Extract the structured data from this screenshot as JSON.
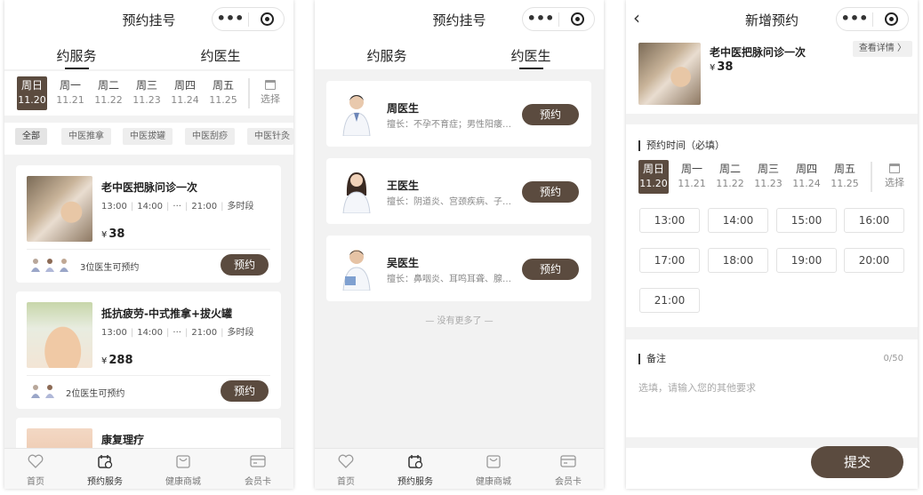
{
  "colors": {
    "accent": "#5b4b3f",
    "page_bg": "#f2f2f2"
  },
  "screen1": {
    "title": "预约挂号",
    "tabs": [
      "约服务",
      "约医生"
    ],
    "active_tab": 0,
    "dates": [
      {
        "weekday": "周日",
        "date": "11.20"
      },
      {
        "weekday": "周一",
        "date": "11.21"
      },
      {
        "weekday": "周二",
        "date": "11.22"
      },
      {
        "weekday": "周三",
        "date": "11.23"
      },
      {
        "weekday": "周四",
        "date": "11.24"
      },
      {
        "weekday": "周五",
        "date": "11.25"
      }
    ],
    "pick_date": "选择",
    "categories": [
      "全部",
      "中医推拿",
      "中医拔罐",
      "中医刮痧",
      "中医针灸"
    ],
    "services": [
      {
        "name": "老中医把脉问诊一次",
        "times": [
          "13:00",
          "14:00",
          "···",
          "21:00",
          "多时段"
        ],
        "price": "38",
        "doctors_text": "3位医生可预约",
        "book": "预约"
      },
      {
        "name": "抵抗疲劳-中式推拿+拔火罐",
        "times": [
          "13:00",
          "14:00",
          "···",
          "21:00",
          "多时段"
        ],
        "price": "288",
        "doctors_text": "2位医生可预约",
        "book": "预约"
      },
      {
        "name": "康复理疗"
      }
    ],
    "currency": "¥",
    "bottom_tabs": [
      "首页",
      "预约服务",
      "健康商城",
      "会员卡"
    ],
    "bottom_icons": [
      "heart-icon",
      "calendar-icon",
      "bag-icon",
      "card-icon"
    ]
  },
  "screen2": {
    "title": "预约挂号",
    "tabs": [
      "约服务",
      "约医生"
    ],
    "active_tab": 1,
    "doctors": [
      {
        "name": "周医生",
        "specialty": "擅长：不孕不育症；男性阳痿早泄",
        "book": "预约"
      },
      {
        "name": "王医生",
        "specialty": "擅长：阴道炎、宫颈疾病、子宫肌瘤",
        "book": "预约"
      },
      {
        "name": "吴医生",
        "specialty": "擅长：鼻咽炎、耳鸣耳聋、腺样体",
        "book": "预约"
      }
    ],
    "no_more": "— 没有更多了 —",
    "bottom_tabs": [
      "首页",
      "预约服务",
      "健康商城",
      "会员卡"
    ]
  },
  "screen3": {
    "title": "新增预约",
    "service": {
      "name": "老中医把脉问诊一次",
      "price": "38",
      "detail_link": "查看详情 〉"
    },
    "time_section_title": "预约时间（必填）",
    "dates": [
      {
        "weekday": "周日",
        "date": "11.20"
      },
      {
        "weekday": "周一",
        "date": "11.21"
      },
      {
        "weekday": "周二",
        "date": "11.22"
      },
      {
        "weekday": "周三",
        "date": "11.23"
      },
      {
        "weekday": "周四",
        "date": "11.24"
      },
      {
        "weekday": "周五",
        "date": "11.25"
      }
    ],
    "pick_date": "选择",
    "slots": [
      "13:00",
      "14:00",
      "15:00",
      "16:00",
      "17:00",
      "18:00",
      "19:00",
      "20:00",
      "21:00"
    ],
    "remark_title": "备注",
    "remark_count": "0/50",
    "remark_placeholder": "选填，请输入您的其他要求",
    "submit": "提交"
  }
}
